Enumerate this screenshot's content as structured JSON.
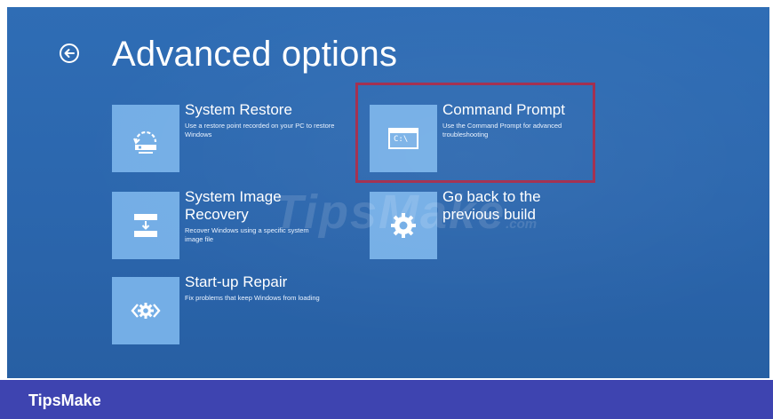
{
  "header": {
    "title": "Advanced options",
    "back_icon": "back-arrow-circle-icon"
  },
  "options": [
    {
      "title": "System Restore",
      "description": "Use a restore point recorded on your PC to restore Windows",
      "icon": "system-restore-icon"
    },
    {
      "title": "Command Prompt",
      "description": "Use the Command Prompt for advanced troubleshooting",
      "icon": "command-prompt-icon",
      "icon_text": "C:\\",
      "highlighted": true
    },
    {
      "title": "System Image Recovery",
      "description": "Recover Windows using a specific system image file",
      "icon": "system-image-recovery-icon"
    },
    {
      "title": "Go back to the previous build",
      "description": "",
      "icon": "gear-icon"
    },
    {
      "title": "Start-up Repair",
      "description": "Fix problems that keep Windows from loading",
      "icon": "startup-repair-icon"
    }
  ],
  "watermark": {
    "text": "TipsMake",
    "suffix": ".com"
  },
  "brand": {
    "label": "TipsMake"
  },
  "colors": {
    "background": "#2b66ad",
    "tile": "#74aee6",
    "highlight": "#a12b4c",
    "brand_bar": "#3e44b0",
    "text": "#ffffff"
  }
}
